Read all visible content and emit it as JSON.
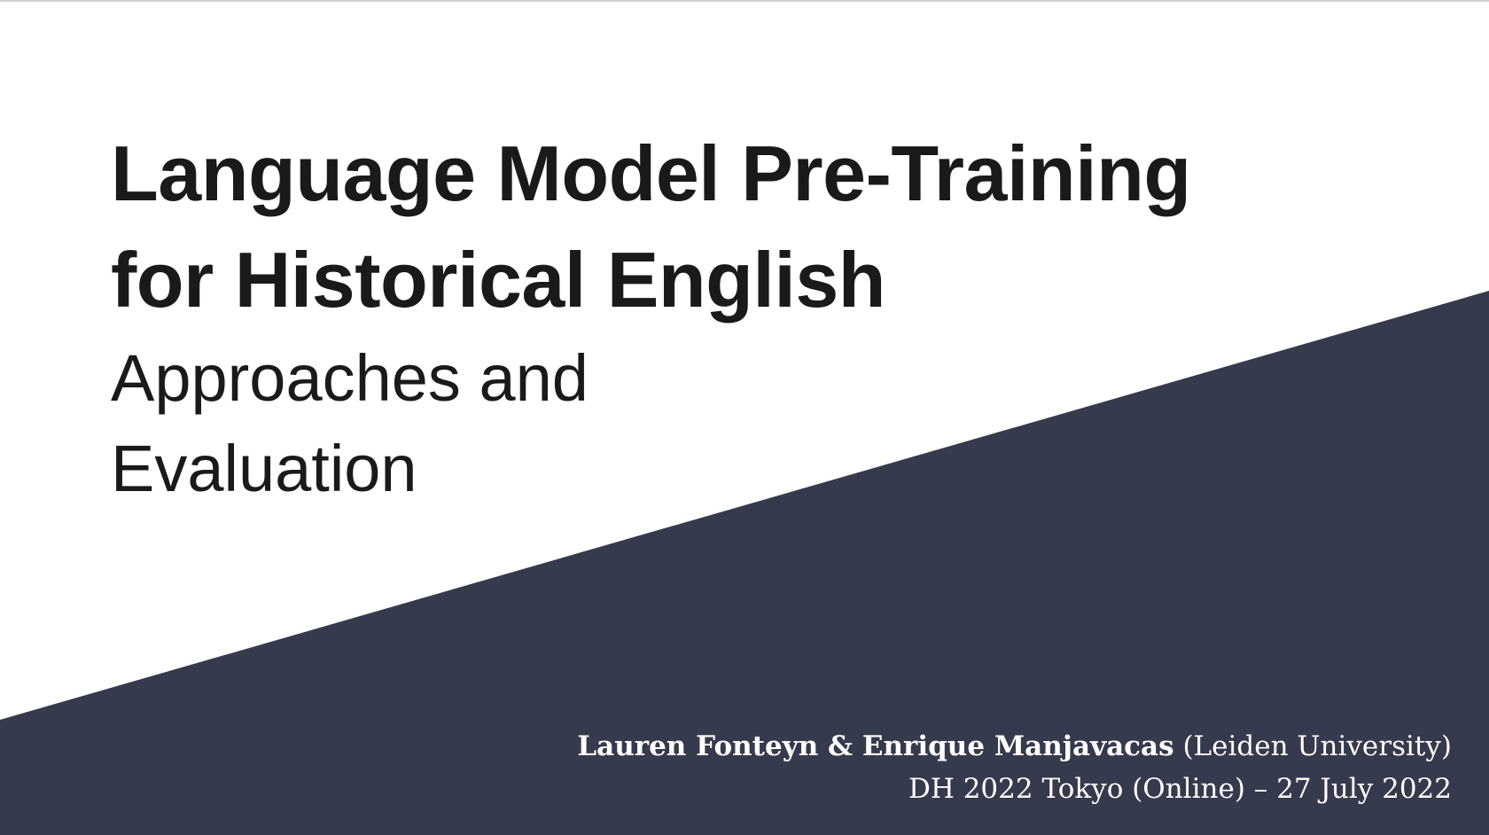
{
  "slide": {
    "title_line_1": "Language Model Pre-Training",
    "title_line_2": "for Historical English",
    "subtitle_line_1": "Approaches and",
    "subtitle_line_2": "Evaluation",
    "authors": "Lauren Fonteyn & Enrique Manjavacas",
    "affiliation": " (Leiden University)",
    "event": "DH 2022 Tokyo (Online) – 27 July 2022"
  },
  "colors": {
    "background": "#ffffff",
    "diagonal_band": "#353a4c",
    "title_text": "#1a1a1a",
    "credit_text": "#ffffff"
  }
}
